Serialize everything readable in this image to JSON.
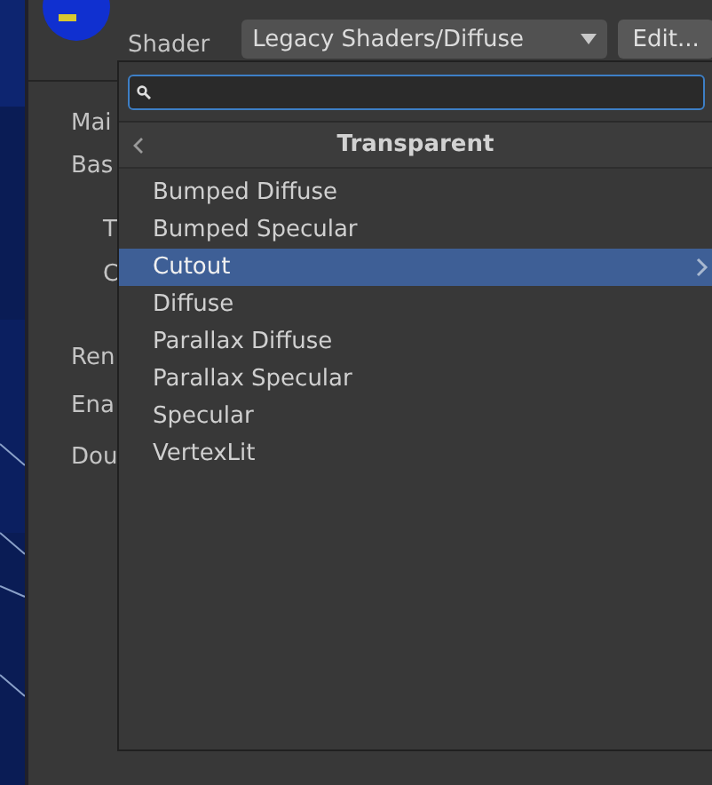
{
  "inspector": {
    "shader_label": "Shader",
    "shader_value": "Legacy Shaders/Diffuse",
    "edit_button": "Edit...",
    "properties": [
      {
        "label": "Mai",
        "indented": false
      },
      {
        "label": "Bas",
        "indented": false
      },
      {
        "label": "T",
        "indented": true
      },
      {
        "label": "C",
        "indented": true
      },
      {
        "label": "Ren",
        "indented": false
      },
      {
        "label": "Ena",
        "indented": false
      },
      {
        "label": "Dou",
        "indented": false
      }
    ]
  },
  "shader_menu": {
    "header": "Transparent",
    "items": [
      {
        "label": "Bumped Diffuse",
        "selected": false,
        "has_submenu": false
      },
      {
        "label": "Bumped Specular",
        "selected": false,
        "has_submenu": false
      },
      {
        "label": "Cutout",
        "selected": true,
        "has_submenu": true
      },
      {
        "label": "Diffuse",
        "selected": false,
        "has_submenu": false
      },
      {
        "label": "Parallax Diffuse",
        "selected": false,
        "has_submenu": false
      },
      {
        "label": "Parallax Specular",
        "selected": false,
        "has_submenu": false
      },
      {
        "label": "Specular",
        "selected": false,
        "has_submenu": false
      },
      {
        "label": "VertexLit",
        "selected": false,
        "has_submenu": false
      }
    ]
  }
}
